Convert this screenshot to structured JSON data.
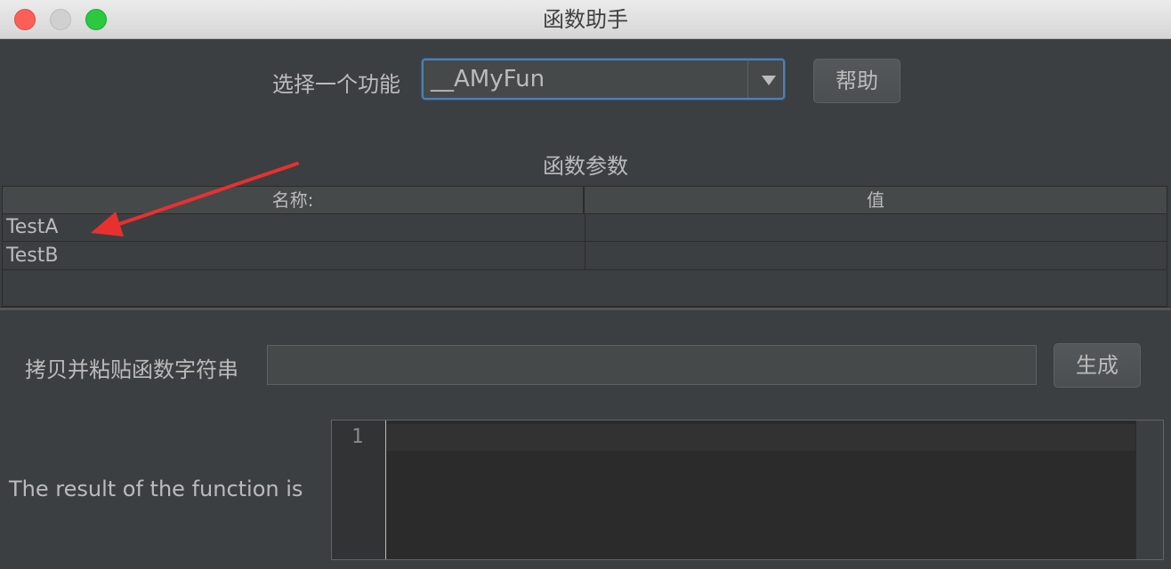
{
  "window": {
    "title": "函数助手"
  },
  "select_function": {
    "label": "选择一个功能",
    "value": "__AMyFun",
    "help_button": "帮助"
  },
  "parameters": {
    "section_title": "函数参数",
    "columns": [
      "名称:",
      "值"
    ],
    "rows": [
      {
        "name": "TestA",
        "value": ""
      },
      {
        "name": "TestB",
        "value": ""
      }
    ]
  },
  "copy_paste": {
    "label": "拷贝并粘贴函数字符串",
    "value": "",
    "generate_button": "生成"
  },
  "result": {
    "label": "The result of the function is",
    "line_number": "1"
  },
  "annotation": {
    "arrow_color": "#e8312f"
  }
}
